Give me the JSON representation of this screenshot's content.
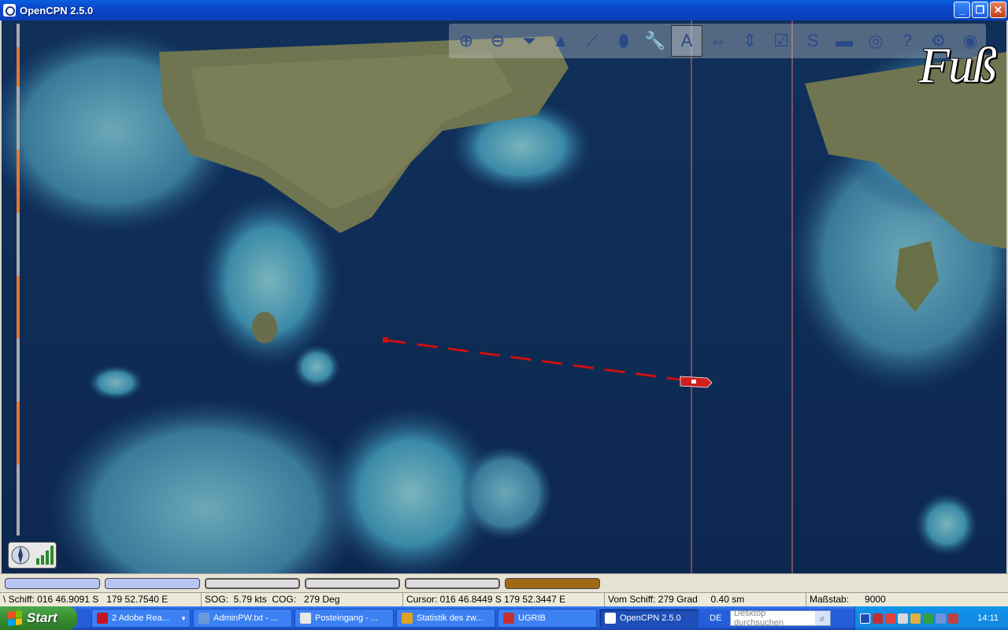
{
  "window": {
    "title": "OpenCPN 2.5.0"
  },
  "toolbar": {
    "tools": [
      {
        "name": "zoom-in-icon",
        "glyph": "⊕"
      },
      {
        "name": "zoom-out-icon",
        "glyph": "⊖"
      },
      {
        "name": "scale-funnel-icon",
        "glyph": "⏷"
      },
      {
        "name": "drop-mark-icon",
        "glyph": "▲"
      },
      {
        "name": "route-icon",
        "glyph": "⟋"
      },
      {
        "name": "follow-ship-icon",
        "glyph": "⬮"
      },
      {
        "name": "settings-wrench-icon",
        "glyph": "🔧"
      },
      {
        "name": "text-toggle-icon",
        "glyph": "A"
      },
      {
        "name": "current-icon",
        "glyph": "⇔"
      },
      {
        "name": "tide-icon",
        "glyph": "⇕"
      },
      {
        "name": "route-manager-icon",
        "glyph": "☑"
      },
      {
        "name": "track-icon",
        "glyph": "S"
      },
      {
        "name": "color-scheme-icon",
        "glyph": "▬"
      },
      {
        "name": "mob-icon",
        "glyph": "◎"
      },
      {
        "name": "help-icon",
        "glyph": "?"
      },
      {
        "name": "gps-status-icon",
        "glyph": "⚙"
      },
      {
        "name": "plugin-icon",
        "glyph": "◉"
      }
    ]
  },
  "overlay": {
    "brand_text": "Fuß"
  },
  "statusbar": {
    "ship": "\\ Schiff: 016 46.9091 S   179 52.7540 E",
    "sog_cog": "SOG:  5.79 kts  COG:   279 Deg",
    "cursor": "Cursor: 016 46.8449 S 179 52.3447 E",
    "from_ship": "Vom Schiff: 279 Grad     0.40 sm",
    "scale": "Maßstab:      9000"
  },
  "taskbar": {
    "start_label": "Start",
    "items": [
      {
        "label": "2 Adobe Rea...",
        "color": "#c8141c",
        "has_arrow": true
      },
      {
        "label": "AdminPW.txt - ...",
        "color": "#6a9ad8",
        "has_arrow": false
      },
      {
        "label": "Posteingang - ...",
        "color": "#e8e8e8",
        "has_arrow": false
      },
      {
        "label": "Statistik des zw...",
        "color": "#e0a020",
        "has_arrow": false
      },
      {
        "label": "UGRIB",
        "color": "#c83030",
        "has_arrow": false
      },
      {
        "label": "OpenCPN 2.5.0",
        "color": "#ffffff",
        "has_arrow": false,
        "active": true
      }
    ],
    "lang": "DE",
    "search_placeholder": "Desktop durchsuchen",
    "clock": "14:11"
  }
}
